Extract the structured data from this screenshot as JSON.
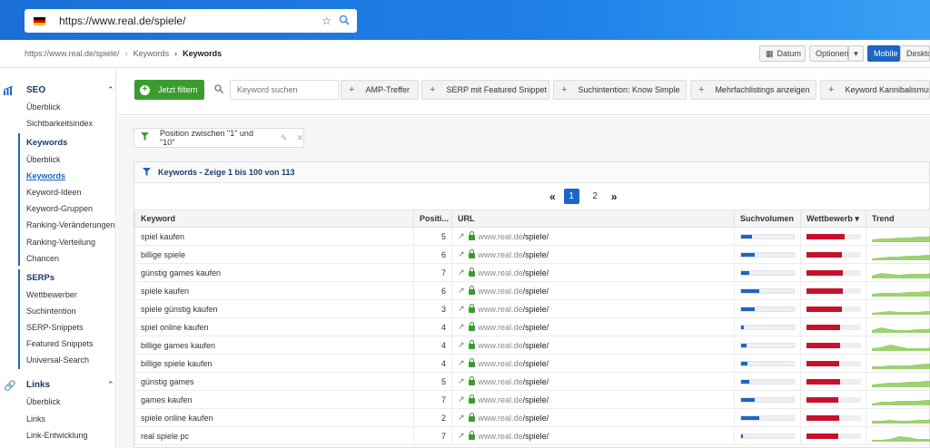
{
  "browser": {
    "url": "https://www.real.de/spiele/"
  },
  "breadcrumb": {
    "items": [
      "https://www.real.de/spiele/",
      "Keywords",
      "Keywords"
    ]
  },
  "toolbar": {
    "datum": "Datum",
    "optionen": "Optionen",
    "mobile": "Mobile",
    "desktop": "Desktop"
  },
  "sidebar": {
    "seo_title": "SEO",
    "seo_items": [
      "Überblick",
      "Sichtbarkeitsindex"
    ],
    "keywords_group": "Keywords",
    "keywords_items": [
      "Überblick",
      "Keywords",
      "Keyword-Ideen",
      "Keyword-Gruppen",
      "Ranking-Veränderungen",
      "Ranking-Verteilung",
      "Chancen"
    ],
    "serps_group": "SERPs",
    "serps_items": [
      "Wettbewerber",
      "Suchintention",
      "SERP-Snippets",
      "Featured Snippets",
      "Universal-Search"
    ],
    "links_title": "Links",
    "links_items": [
      "Überblick",
      "Links",
      "Link-Entwicklung"
    ]
  },
  "filters": {
    "apply_label": "Jetzt filtern",
    "search_placeholder": "Keyword suchen",
    "chips": [
      "AMP-Treffer",
      "SERP mit Featured Snippet",
      "Suchintention: Know Simple",
      "Mehrfachlistings anzeigen",
      "Keyword Kannibalismus"
    ],
    "active_filter": "Position zwischen \"1\" und \"10\""
  },
  "panel": {
    "title": "Keywords - Zeige 1 bis 100 von 113",
    "pages": [
      "1",
      "2"
    ],
    "current_page": "1"
  },
  "table": {
    "columns": [
      "Keyword",
      "Positi...",
      "URL",
      "Suchvolumen",
      "Wettbewerb",
      "Trend"
    ],
    "rows": [
      {
        "keyword": "spiel kaufen",
        "position": "5",
        "domain": "www.real.de",
        "path": "/spiele/",
        "volume": 0.2,
        "competition": 0.7
      },
      {
        "keyword": "billige spiele",
        "position": "6",
        "domain": "www.real.de",
        "path": "/spiele/",
        "volume": 0.25,
        "competition": 0.65
      },
      {
        "keyword": "günstig games kaufen",
        "position": "7",
        "domain": "www.real.de",
        "path": "/spiele/",
        "volume": 0.15,
        "competition": 0.66
      },
      {
        "keyword": "spiele kaufen",
        "position": "6",
        "domain": "www.real.de",
        "path": "/spiele/",
        "volume": 0.35,
        "competition": 0.66
      },
      {
        "keyword": "spiele günstig kaufen",
        "position": "3",
        "domain": "www.real.de",
        "path": "/spiele/",
        "volume": 0.25,
        "competition": 0.65
      },
      {
        "keyword": "spiel online kaufen",
        "position": "4",
        "domain": "www.real.de",
        "path": "/spiele/",
        "volume": 0.05,
        "competition": 0.62
      },
      {
        "keyword": "billige games kaufen",
        "position": "4",
        "domain": "www.real.de",
        "path": "/spiele/",
        "volume": 0.1,
        "competition": 0.62
      },
      {
        "keyword": "billige spiele kaufen",
        "position": "4",
        "domain": "www.real.de",
        "path": "/spiele/",
        "volume": 0.12,
        "competition": 0.6
      },
      {
        "keyword": "günstig games",
        "position": "5",
        "domain": "www.real.de",
        "path": "/spiele/",
        "volume": 0.15,
        "competition": 0.62
      },
      {
        "keyword": "games kaufen",
        "position": "7",
        "domain": "www.real.de",
        "path": "/spiele/",
        "volume": 0.25,
        "competition": 0.58
      },
      {
        "keyword": "spiele online kaufen",
        "position": "2",
        "domain": "www.real.de",
        "path": "/spiele/",
        "volume": 0.35,
        "competition": 0.6
      },
      {
        "keyword": "real spiele pc",
        "position": "7",
        "domain": "www.real.de",
        "path": "/spiele/",
        "volume": 0.04,
        "competition": 0.58
      }
    ]
  },
  "colors": {
    "primary": "#1d65c4",
    "green": "#3b9c2e",
    "red": "#c8102e",
    "trend": "#7cc242"
  }
}
